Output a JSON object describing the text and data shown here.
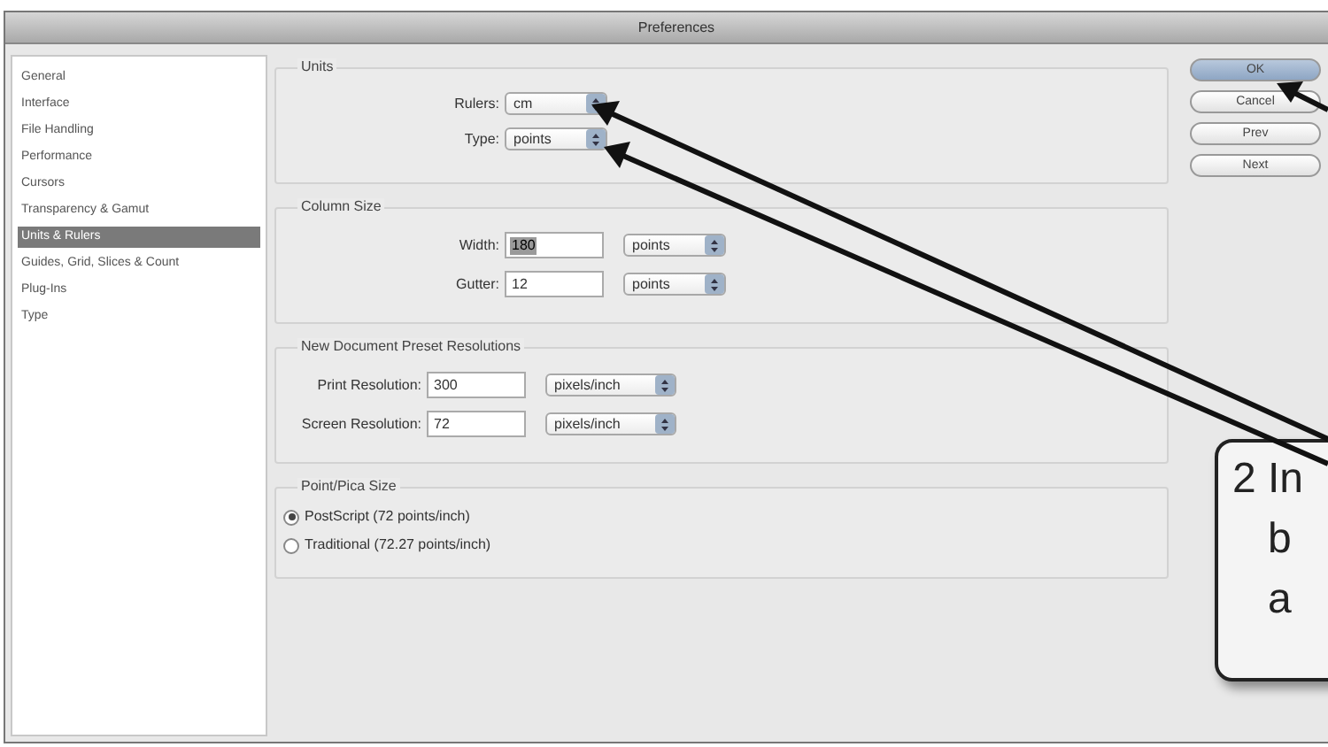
{
  "window": {
    "title": "Preferences"
  },
  "sidebar": {
    "items": [
      {
        "label": "General",
        "selected": false
      },
      {
        "label": "Interface",
        "selected": false
      },
      {
        "label": "File Handling",
        "selected": false
      },
      {
        "label": "Performance",
        "selected": false
      },
      {
        "label": "Cursors",
        "selected": false
      },
      {
        "label": "Transparency & Gamut",
        "selected": false
      },
      {
        "label": "Units & Rulers",
        "selected": true
      },
      {
        "label": "Guides, Grid, Slices & Count",
        "selected": false
      },
      {
        "label": "Plug-Ins",
        "selected": false
      },
      {
        "label": "Type",
        "selected": false
      }
    ]
  },
  "groups": [
    {
      "title": "Units",
      "rows": [
        {
          "label": "Rulers:",
          "select": "cm"
        },
        {
          "label": "Type:",
          "select": "points"
        }
      ]
    },
    {
      "title": "Column Size",
      "rows": [
        {
          "label": "Width:",
          "value": "180",
          "value_selected": true,
          "select": "points"
        },
        {
          "label": "Gutter:",
          "value": "12",
          "value_selected": false,
          "select": "points"
        }
      ]
    },
    {
      "title": "New Document Preset Resolutions",
      "rows": [
        {
          "label": "Print Resolution:",
          "value": "300",
          "value_selected": false,
          "select": "pixels/inch"
        },
        {
          "label": "Screen Resolution:",
          "value": "72",
          "value_selected": false,
          "select": "pixels/inch"
        }
      ]
    }
  ],
  "point_pica": {
    "title": "Point/Pica Size",
    "options": [
      {
        "label": "PostScript (72 points/inch)",
        "selected": true
      },
      {
        "label": "Traditional (72.27 points/inch)",
        "selected": false
      }
    ]
  },
  "buttons": [
    {
      "label": "OK",
      "default": true
    },
    {
      "label": "Cancel",
      "default": false
    },
    {
      "label": "Prev",
      "default": false
    },
    {
      "label": "Next",
      "default": false
    }
  ],
  "callout": {
    "lines": [
      "2 In",
      "b",
      "a"
    ]
  }
}
